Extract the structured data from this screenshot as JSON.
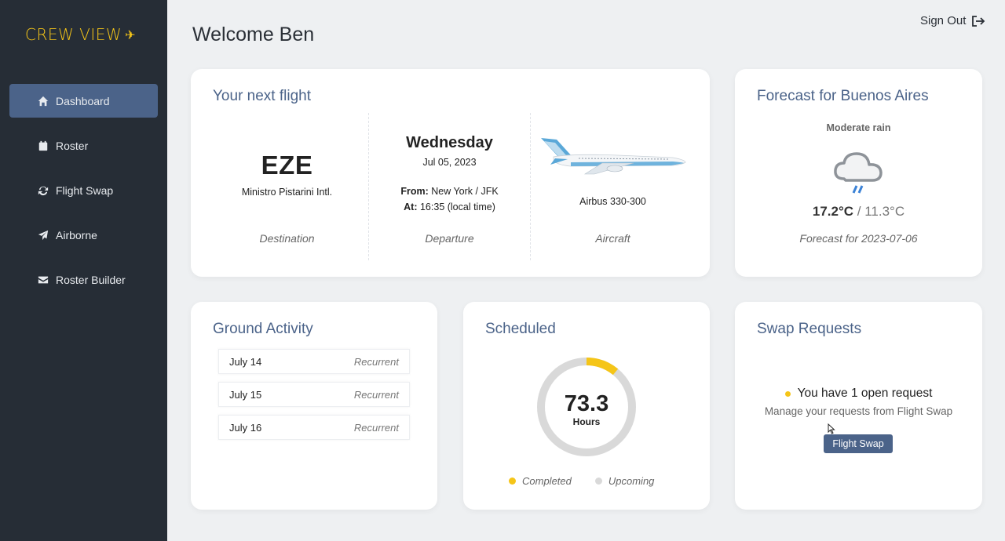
{
  "app": {
    "logo_text": "CREW VIEW",
    "logo_icon": "plane-icon"
  },
  "sidebar": {
    "items": [
      {
        "label": "Dashboard",
        "icon": "home-icon",
        "active": true
      },
      {
        "label": "Roster",
        "icon": "calendar-icon"
      },
      {
        "label": "Flight Swap",
        "icon": "sync-icon"
      },
      {
        "label": "Airborne",
        "icon": "paper-plane-icon"
      },
      {
        "label": "Roster Builder",
        "icon": "envelope-icon"
      }
    ]
  },
  "header": {
    "welcome": "Welcome Ben",
    "signout_label": "Sign Out"
  },
  "next_flight": {
    "title": "Your next flight",
    "destination_code": "EZE",
    "destination_airport": "Ministro Pistarini Intl.",
    "destination_label": "Destination",
    "weekday": "Wednesday",
    "date": "Jul 05, 2023",
    "from_label": "From:",
    "from_value": "New York / JFK",
    "at_label": "At:",
    "at_value": "16:35 (local time)",
    "departure_label": "Departure",
    "aircraft": "Airbus 330-300",
    "aircraft_label": "Aircraft"
  },
  "forecast": {
    "title": "Forecast for Buenos Aires",
    "condition": "Moderate rain",
    "high": "17.2°C",
    "separator": "/",
    "low": "11.3°C",
    "date_line": "Forecast for 2023-07-06"
  },
  "ground_activity": {
    "title": "Ground Activity",
    "rows": [
      {
        "date": "July 14",
        "type": "Recurrent"
      },
      {
        "date": "July 15",
        "type": "Recurrent"
      },
      {
        "date": "July 16",
        "type": "Recurrent"
      }
    ]
  },
  "scheduled": {
    "title": "Scheduled",
    "value": "73.3",
    "unit": "Hours",
    "completed_fraction": 0.11,
    "legend_completed": "Completed",
    "legend_upcoming": "Upcoming",
    "color_completed": "#f5c518",
    "color_upcoming": "#d9d9d9"
  },
  "swap_requests": {
    "title": "Swap Requests",
    "open_text": "You have 1 open request",
    "sub_text": "Manage your requests from Flight Swap",
    "button_label": "Flight Swap"
  },
  "colors": {
    "accent": "#4b6389",
    "brand": "#f5c518",
    "sidebar": "#262d36"
  }
}
